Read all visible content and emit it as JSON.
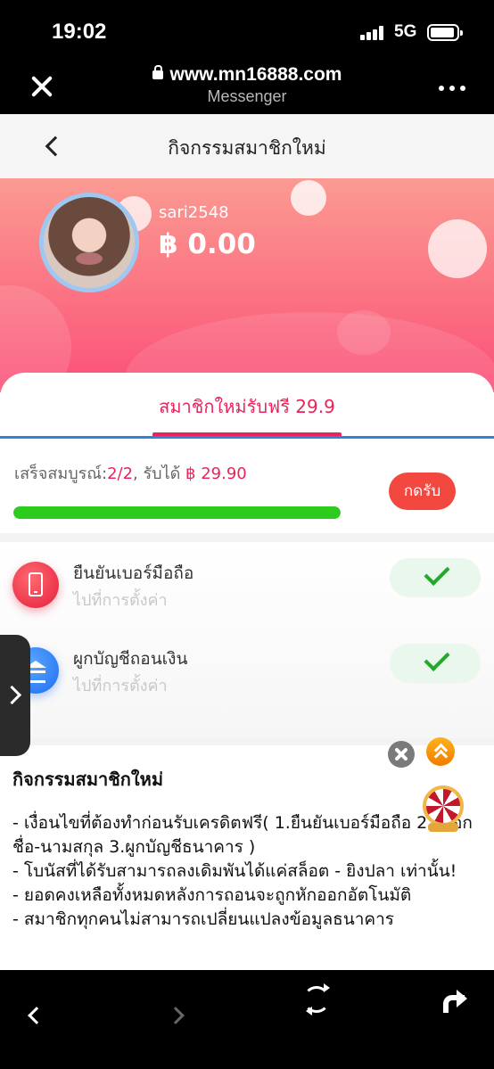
{
  "status": {
    "time": "19:02",
    "network": "5G"
  },
  "browser": {
    "url": "www.mn16888.com",
    "app": "Messenger"
  },
  "nav": {
    "title": "กิจกรรมสมาชิกใหม่"
  },
  "profile": {
    "username": "sari2548",
    "balance": "฿ 0.00"
  },
  "tab": {
    "label": "สมาชิกใหม่รับฟรี 29.9"
  },
  "progress": {
    "label_prefix": "เสร็จสมบูรณ์:",
    "count": "2/2",
    "label_mid": ", รับได้ ",
    "amount": "฿ 29.90",
    "claim_label": "กดรับ",
    "completed_fraction": 1.0
  },
  "tasks": [
    {
      "title": "ยืนยันเบอร์มือถือ",
      "subtitle": "ไปที่การตั้งค่า",
      "icon": "phone-icon"
    },
    {
      "title": "ผูกบัญชีถอนเงิน",
      "subtitle": "ไปที่การตั้งค่า",
      "icon": "bank-icon"
    }
  ],
  "rules": {
    "title": "กิจกรรมสมาชิกใหม่",
    "lines": [
      "- เงื่อนไขที่ต้องทำก่อนรับเครดิตฟรี( 1.ยืนยันเบอร์มือถือ  2.กรอกชื่อ-นามสกุล  3.ผูกบัญชีธนาคาร )",
      "- โบนัสที่ได้รับสามารถลงเดิมพันได้แค่สล็อต - ยิงปลา เท่านั้น!",
      "- ยอดคงเหลือทั้งหมดหลังการถอนจะถูกหักออกอัตโนมัติ",
      "- สมาชิกทุกคนไม่สามารถเปลี่ยนแปลงข้อมูลธนาคาร"
    ]
  },
  "colors": {
    "accent": "#e8245a",
    "progress": "#2ecb1f",
    "claim": "#f2483f",
    "check": "#25a92d"
  }
}
